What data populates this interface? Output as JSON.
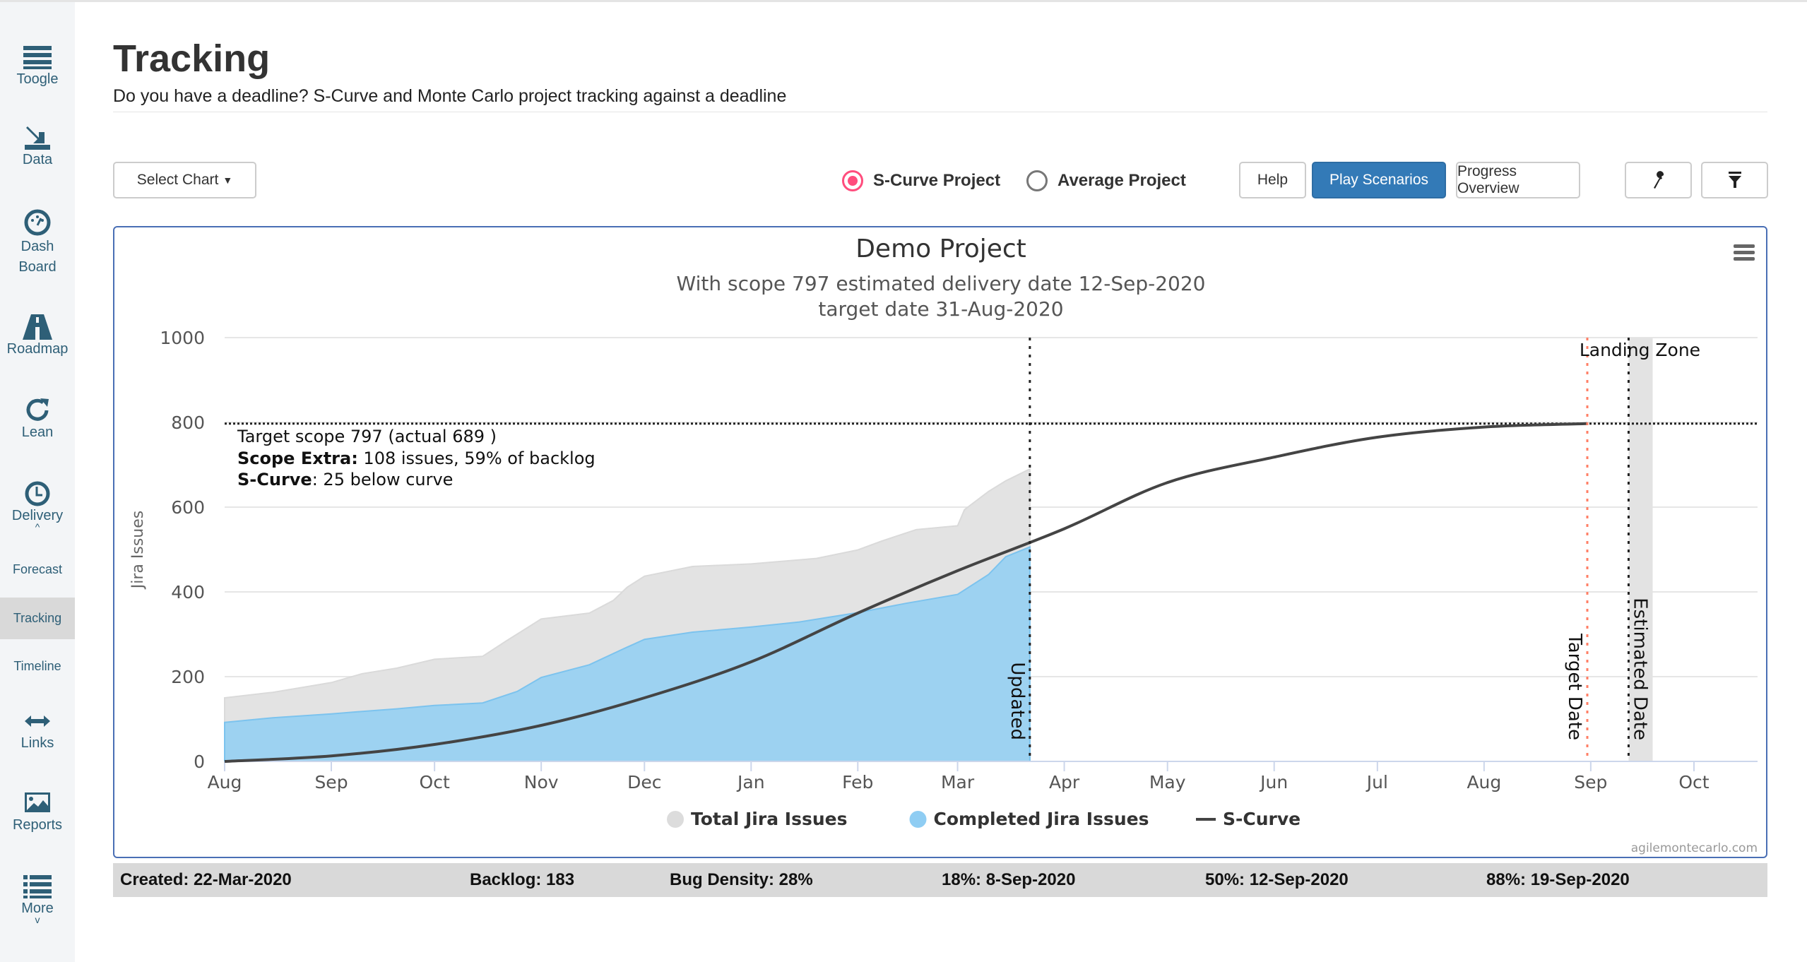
{
  "sidebar": {
    "items": [
      {
        "label": "Toogle",
        "icon": "bars-icon"
      },
      {
        "label": "Data",
        "icon": "upload-icon"
      },
      {
        "label": "Dash Board",
        "icon": "dashboard-icon"
      },
      {
        "label": "Roadmap",
        "icon": "road-icon"
      },
      {
        "label": "Lean",
        "icon": "refresh-icon"
      },
      {
        "label": "Delivery",
        "icon": "clock-icon"
      },
      {
        "label": "Forecast"
      },
      {
        "label": "Tracking",
        "active": true
      },
      {
        "label": "Timeline"
      },
      {
        "label": "Links",
        "icon": "arrows-h-icon"
      },
      {
        "label": "Reports",
        "icon": "image-icon"
      },
      {
        "label": "More",
        "icon": "list-icon"
      }
    ]
  },
  "header": {
    "title": "Tracking",
    "subtitle": "Do you have a deadline? S-Curve and Monte Carlo project tracking against a deadline"
  },
  "toolbar": {
    "select_chart": "Select Chart",
    "radios": [
      {
        "label": "S-Curve Project",
        "checked": true
      },
      {
        "label": "Average Project",
        "checked": false
      }
    ],
    "help": "Help",
    "play_scenarios": "Play Scenarios",
    "progress_overview": "Progress Overview",
    "settings_icon": "wrench-icon",
    "filter_icon": "filter-icon",
    "accent": "#337ab7"
  },
  "chart_data": {
    "type": "area",
    "title": "Demo Project",
    "subtitle_lines": [
      "With scope 797 estimated delivery date 12-Sep-2020",
      "target date 31-Aug-2020"
    ],
    "ylabel": "Jira Issues",
    "ylim": [
      0,
      1000
    ],
    "yticks": [
      0,
      200,
      400,
      600,
      800,
      1000
    ],
    "xlim": [
      "2019-08-01",
      "2020-10-01"
    ],
    "xticks": [
      {
        "date": "2019-08-01",
        "label": "Aug"
      },
      {
        "date": "2019-09-01",
        "label": "Sep"
      },
      {
        "date": "2019-10-01",
        "label": "Oct"
      },
      {
        "date": "2019-11-01",
        "label": "Nov"
      },
      {
        "date": "2019-12-01",
        "label": "Dec"
      },
      {
        "date": "2020-01-01",
        "label": "Jan"
      },
      {
        "date": "2020-02-01",
        "label": "Feb"
      },
      {
        "date": "2020-03-01",
        "label": "Mar"
      },
      {
        "date": "2020-04-01",
        "label": "Apr"
      },
      {
        "date": "2020-05-01",
        "label": "May"
      },
      {
        "date": "2020-06-01",
        "label": "Jun"
      },
      {
        "date": "2020-07-01",
        "label": "Jul"
      },
      {
        "date": "2020-08-01",
        "label": "Aug"
      },
      {
        "date": "2020-09-01",
        "label": "Sep"
      },
      {
        "date": "2020-10-01",
        "label": "Oct"
      }
    ],
    "grid": true,
    "legend_position": "bottom",
    "series": [
      {
        "name": "Total Jira Issues",
        "color": "#e3e3e3",
        "kind": "area",
        "points": [
          [
            "2019-08-01",
            150
          ],
          [
            "2019-08-15",
            163
          ],
          [
            "2019-09-01",
            186
          ],
          [
            "2019-09-10",
            207
          ],
          [
            "2019-09-20",
            220
          ],
          [
            "2019-10-01",
            241
          ],
          [
            "2019-10-15",
            248
          ],
          [
            "2019-10-22",
            285
          ],
          [
            "2019-11-01",
            336
          ],
          [
            "2019-11-15",
            350
          ],
          [
            "2019-11-22",
            380
          ],
          [
            "2019-11-26",
            411
          ],
          [
            "2019-12-01",
            437
          ],
          [
            "2019-12-15",
            460
          ],
          [
            "2020-01-01",
            466
          ],
          [
            "2020-01-20",
            479
          ],
          [
            "2020-02-01",
            499
          ],
          [
            "2020-02-08",
            520
          ],
          [
            "2020-02-18",
            547
          ],
          [
            "2020-03-01",
            556
          ],
          [
            "2020-03-03",
            594
          ],
          [
            "2020-03-10",
            637
          ],
          [
            "2020-03-15",
            662
          ],
          [
            "2020-03-22",
            690
          ]
        ]
      },
      {
        "name": "Completed Jira Issues",
        "color": "#9dd2f1",
        "kind": "area",
        "points": [
          [
            "2019-08-01",
            92
          ],
          [
            "2019-08-15",
            103
          ],
          [
            "2019-09-01",
            112
          ],
          [
            "2019-09-10",
            118
          ],
          [
            "2019-09-20",
            124
          ],
          [
            "2019-10-01",
            132
          ],
          [
            "2019-10-15",
            138
          ],
          [
            "2019-10-25",
            165
          ],
          [
            "2019-11-01",
            198
          ],
          [
            "2019-11-15",
            228
          ],
          [
            "2019-11-25",
            266
          ],
          [
            "2019-12-01",
            288
          ],
          [
            "2019-12-15",
            305
          ],
          [
            "2020-01-01",
            317
          ],
          [
            "2020-01-15",
            329
          ],
          [
            "2020-02-01",
            351
          ],
          [
            "2020-02-15",
            373
          ],
          [
            "2020-03-01",
            394
          ],
          [
            "2020-03-10",
            441
          ],
          [
            "2020-03-15",
            483
          ],
          [
            "2020-03-22",
            506
          ]
        ]
      },
      {
        "name": "S-Curve",
        "color": "#444444",
        "kind": "line",
        "points": [
          [
            "2019-08-01",
            0
          ],
          [
            "2019-09-01",
            13
          ],
          [
            "2019-10-01",
            40
          ],
          [
            "2019-11-01",
            85
          ],
          [
            "2019-12-01",
            150
          ],
          [
            "2020-01-01",
            235
          ],
          [
            "2020-02-01",
            350
          ],
          [
            "2020-03-01",
            450
          ],
          [
            "2020-04-01",
            549
          ],
          [
            "2020-05-01",
            658
          ],
          [
            "2020-06-01",
            718
          ],
          [
            "2020-07-01",
            765
          ],
          [
            "2020-08-01",
            789
          ],
          [
            "2020-08-31",
            797
          ]
        ]
      }
    ],
    "target_scope": 797,
    "annotations": {
      "scope_line1": "Target scope 797 (actual 689 )",
      "scope_extra_label": "Scope Extra:",
      "scope_extra_text": " 108 issues, 59% of backlog",
      "scurve_label": "S-Curve",
      "scurve_text": ": 25 below curve"
    },
    "plot_lines": [
      {
        "date": "2020-03-22",
        "label": "Updated",
        "color": "#222222"
      },
      {
        "date": "2020-08-31",
        "label": "Target Date",
        "color": "#ff7f66"
      },
      {
        "date": "2020-09-12",
        "label": "Estimated Date",
        "color": "#222222"
      }
    ],
    "landing_zone": {
      "label": "Landing Zone",
      "from": "2020-09-12",
      "to": "2020-09-19"
    },
    "credit": "agilemontecarlo.com",
    "menu_icon": "hamburger-icon"
  },
  "footer": {
    "created": "Created: 22-Mar-2020",
    "backlog": "Backlog: 183",
    "bug_density": "Bug Density: 28%",
    "p18": "18%: 8-Sep-2020",
    "p50": "50%: 12-Sep-2020",
    "p88": "88%: 19-Sep-2020"
  }
}
